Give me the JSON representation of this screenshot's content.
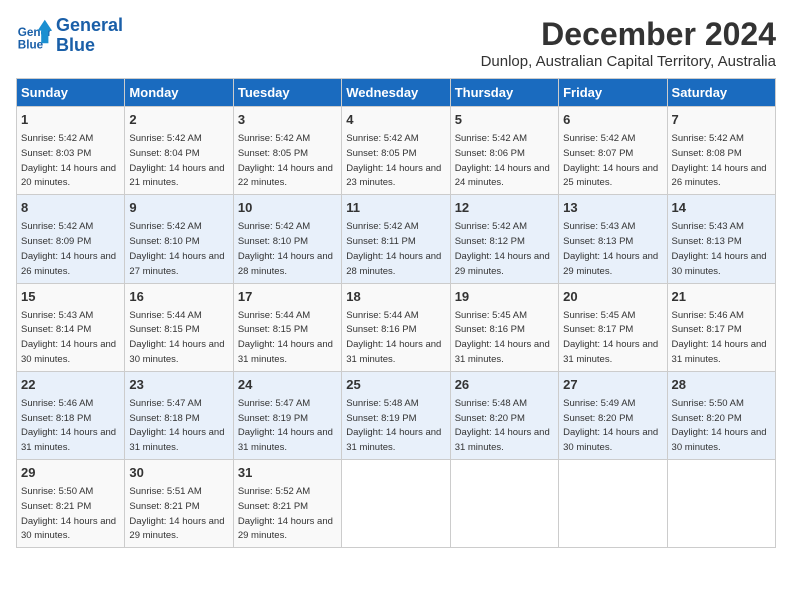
{
  "logo": {
    "line1": "General",
    "line2": "Blue"
  },
  "title": "December 2024",
  "location": "Dunlop, Australian Capital Territory, Australia",
  "days_of_week": [
    "Sunday",
    "Monday",
    "Tuesday",
    "Wednesday",
    "Thursday",
    "Friday",
    "Saturday"
  ],
  "weeks": [
    [
      {
        "day": "1",
        "sunrise": "Sunrise: 5:42 AM",
        "sunset": "Sunset: 8:03 PM",
        "daylight": "Daylight: 14 hours and 20 minutes."
      },
      {
        "day": "2",
        "sunrise": "Sunrise: 5:42 AM",
        "sunset": "Sunset: 8:04 PM",
        "daylight": "Daylight: 14 hours and 21 minutes."
      },
      {
        "day": "3",
        "sunrise": "Sunrise: 5:42 AM",
        "sunset": "Sunset: 8:05 PM",
        "daylight": "Daylight: 14 hours and 22 minutes."
      },
      {
        "day": "4",
        "sunrise": "Sunrise: 5:42 AM",
        "sunset": "Sunset: 8:05 PM",
        "daylight": "Daylight: 14 hours and 23 minutes."
      },
      {
        "day": "5",
        "sunrise": "Sunrise: 5:42 AM",
        "sunset": "Sunset: 8:06 PM",
        "daylight": "Daylight: 14 hours and 24 minutes."
      },
      {
        "day": "6",
        "sunrise": "Sunrise: 5:42 AM",
        "sunset": "Sunset: 8:07 PM",
        "daylight": "Daylight: 14 hours and 25 minutes."
      },
      {
        "day": "7",
        "sunrise": "Sunrise: 5:42 AM",
        "sunset": "Sunset: 8:08 PM",
        "daylight": "Daylight: 14 hours and 26 minutes."
      }
    ],
    [
      {
        "day": "8",
        "sunrise": "Sunrise: 5:42 AM",
        "sunset": "Sunset: 8:09 PM",
        "daylight": "Daylight: 14 hours and 26 minutes."
      },
      {
        "day": "9",
        "sunrise": "Sunrise: 5:42 AM",
        "sunset": "Sunset: 8:10 PM",
        "daylight": "Daylight: 14 hours and 27 minutes."
      },
      {
        "day": "10",
        "sunrise": "Sunrise: 5:42 AM",
        "sunset": "Sunset: 8:10 PM",
        "daylight": "Daylight: 14 hours and 28 minutes."
      },
      {
        "day": "11",
        "sunrise": "Sunrise: 5:42 AM",
        "sunset": "Sunset: 8:11 PM",
        "daylight": "Daylight: 14 hours and 28 minutes."
      },
      {
        "day": "12",
        "sunrise": "Sunrise: 5:42 AM",
        "sunset": "Sunset: 8:12 PM",
        "daylight": "Daylight: 14 hours and 29 minutes."
      },
      {
        "day": "13",
        "sunrise": "Sunrise: 5:43 AM",
        "sunset": "Sunset: 8:13 PM",
        "daylight": "Daylight: 14 hours and 29 minutes."
      },
      {
        "day": "14",
        "sunrise": "Sunrise: 5:43 AM",
        "sunset": "Sunset: 8:13 PM",
        "daylight": "Daylight: 14 hours and 30 minutes."
      }
    ],
    [
      {
        "day": "15",
        "sunrise": "Sunrise: 5:43 AM",
        "sunset": "Sunset: 8:14 PM",
        "daylight": "Daylight: 14 hours and 30 minutes."
      },
      {
        "day": "16",
        "sunrise": "Sunrise: 5:44 AM",
        "sunset": "Sunset: 8:15 PM",
        "daylight": "Daylight: 14 hours and 30 minutes."
      },
      {
        "day": "17",
        "sunrise": "Sunrise: 5:44 AM",
        "sunset": "Sunset: 8:15 PM",
        "daylight": "Daylight: 14 hours and 31 minutes."
      },
      {
        "day": "18",
        "sunrise": "Sunrise: 5:44 AM",
        "sunset": "Sunset: 8:16 PM",
        "daylight": "Daylight: 14 hours and 31 minutes."
      },
      {
        "day": "19",
        "sunrise": "Sunrise: 5:45 AM",
        "sunset": "Sunset: 8:16 PM",
        "daylight": "Daylight: 14 hours and 31 minutes."
      },
      {
        "day": "20",
        "sunrise": "Sunrise: 5:45 AM",
        "sunset": "Sunset: 8:17 PM",
        "daylight": "Daylight: 14 hours and 31 minutes."
      },
      {
        "day": "21",
        "sunrise": "Sunrise: 5:46 AM",
        "sunset": "Sunset: 8:17 PM",
        "daylight": "Daylight: 14 hours and 31 minutes."
      }
    ],
    [
      {
        "day": "22",
        "sunrise": "Sunrise: 5:46 AM",
        "sunset": "Sunset: 8:18 PM",
        "daylight": "Daylight: 14 hours and 31 minutes."
      },
      {
        "day": "23",
        "sunrise": "Sunrise: 5:47 AM",
        "sunset": "Sunset: 8:18 PM",
        "daylight": "Daylight: 14 hours and 31 minutes."
      },
      {
        "day": "24",
        "sunrise": "Sunrise: 5:47 AM",
        "sunset": "Sunset: 8:19 PM",
        "daylight": "Daylight: 14 hours and 31 minutes."
      },
      {
        "day": "25",
        "sunrise": "Sunrise: 5:48 AM",
        "sunset": "Sunset: 8:19 PM",
        "daylight": "Daylight: 14 hours and 31 minutes."
      },
      {
        "day": "26",
        "sunrise": "Sunrise: 5:48 AM",
        "sunset": "Sunset: 8:20 PM",
        "daylight": "Daylight: 14 hours and 31 minutes."
      },
      {
        "day": "27",
        "sunrise": "Sunrise: 5:49 AM",
        "sunset": "Sunset: 8:20 PM",
        "daylight": "Daylight: 14 hours and 30 minutes."
      },
      {
        "day": "28",
        "sunrise": "Sunrise: 5:50 AM",
        "sunset": "Sunset: 8:20 PM",
        "daylight": "Daylight: 14 hours and 30 minutes."
      }
    ],
    [
      {
        "day": "29",
        "sunrise": "Sunrise: 5:50 AM",
        "sunset": "Sunset: 8:21 PM",
        "daylight": "Daylight: 14 hours and 30 minutes."
      },
      {
        "day": "30",
        "sunrise": "Sunrise: 5:51 AM",
        "sunset": "Sunset: 8:21 PM",
        "daylight": "Daylight: 14 hours and 29 minutes."
      },
      {
        "day": "31",
        "sunrise": "Sunrise: 5:52 AM",
        "sunset": "Sunset: 8:21 PM",
        "daylight": "Daylight: 14 hours and 29 minutes."
      },
      null,
      null,
      null,
      null
    ]
  ]
}
